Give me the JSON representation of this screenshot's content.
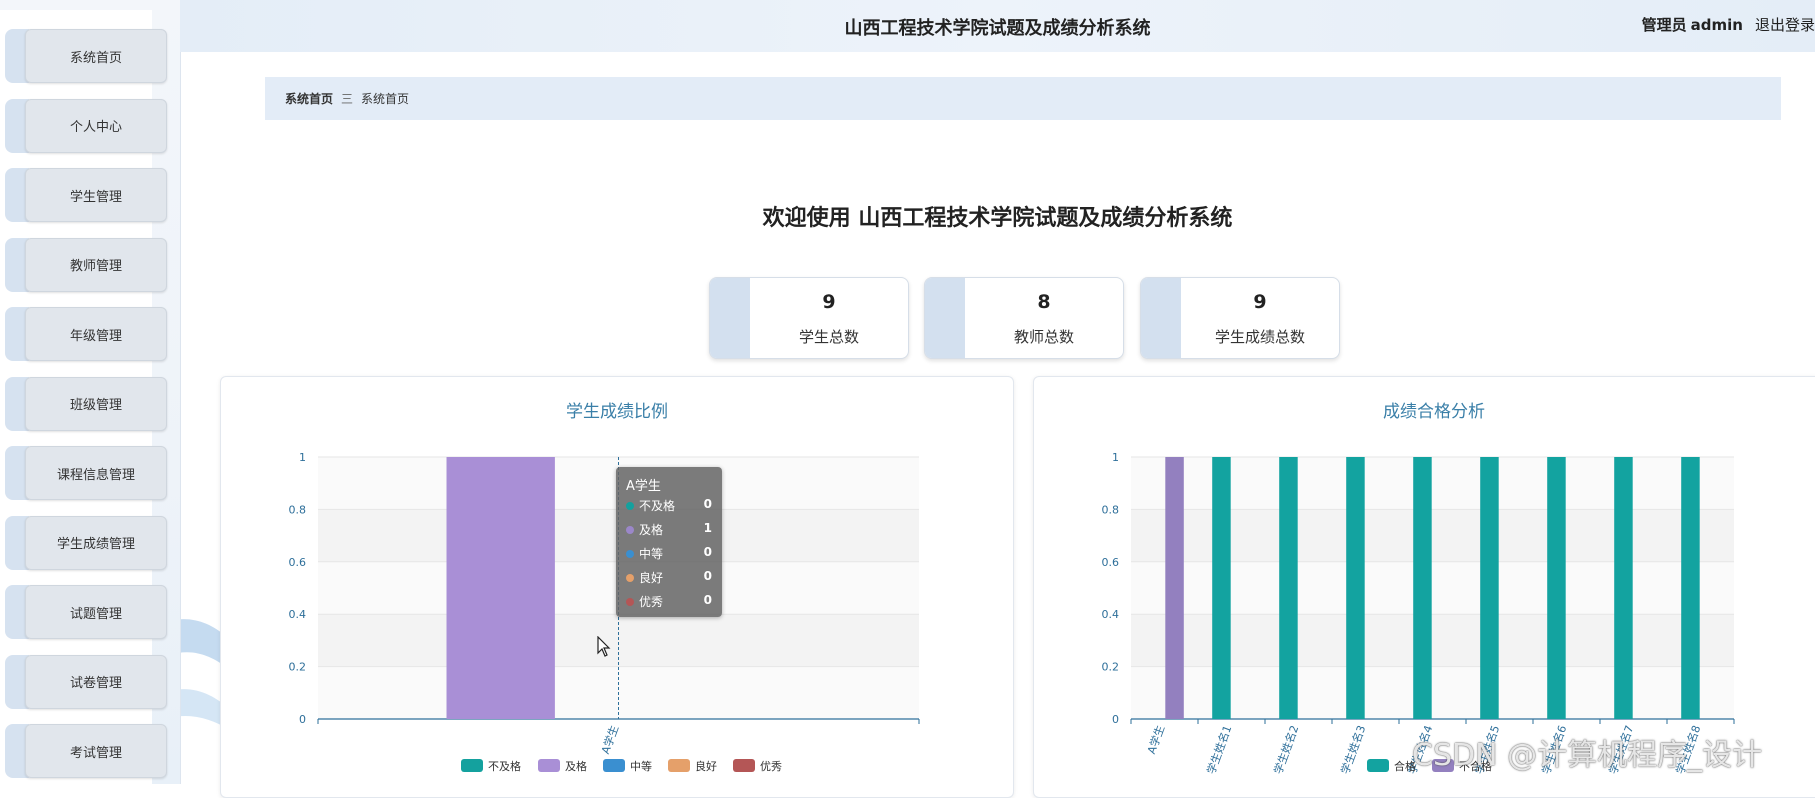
{
  "header": {
    "title": "山西工程技术学院试题及成绩分析系统",
    "user_role": "管理员",
    "user_name": "admin",
    "logout_label": "退出登录"
  },
  "sidebar": {
    "items": [
      {
        "label": "系统首页"
      },
      {
        "label": "个人中心"
      },
      {
        "label": "学生管理"
      },
      {
        "label": "教师管理"
      },
      {
        "label": "年级管理"
      },
      {
        "label": "班级管理"
      },
      {
        "label": "课程信息管理"
      },
      {
        "label": "学生成绩管理"
      },
      {
        "label": "试题管理"
      },
      {
        "label": "试卷管理"
      },
      {
        "label": "考试管理"
      }
    ]
  },
  "breadcrumb": {
    "home": "系统首页",
    "separator": "三",
    "current": "系统首页"
  },
  "welcome": "欢迎使用 山西工程技术学院试题及成绩分析系统",
  "stats": [
    {
      "value": "9",
      "label": "学生总数"
    },
    {
      "value": "8",
      "label": "教师总数"
    },
    {
      "value": "9",
      "label": "学生成绩总数"
    }
  ],
  "tooltip": {
    "title": "A学生",
    "rows": [
      {
        "name": "不及格",
        "value": "0",
        "color": "#14a19e"
      },
      {
        "name": "及格",
        "value": "1",
        "color": "#9b87c9"
      },
      {
        "name": "中等",
        "value": "0",
        "color": "#3a8fd0"
      },
      {
        "name": "良好",
        "value": "0",
        "color": "#e5a06a"
      },
      {
        "name": "优秀",
        "value": "0",
        "color": "#b45656"
      }
    ]
  },
  "watermark": "CSDN @计算机程序_设计",
  "chart_data": [
    {
      "type": "bar",
      "title": "学生成绩比例",
      "categories": [
        "A学生"
      ],
      "series": [
        {
          "name": "不及格",
          "values": [
            0
          ],
          "color": "#14a19e"
        },
        {
          "name": "及格",
          "values": [
            1
          ],
          "color": "#a98fd6"
        },
        {
          "name": "中等",
          "values": [
            0
          ],
          "color": "#3a8fd0"
        },
        {
          "name": "良好",
          "values": [
            0
          ],
          "color": "#e5a06a"
        },
        {
          "name": "优秀",
          "values": [
            0
          ],
          "color": "#b45656"
        }
      ],
      "yticks": [
        "0",
        "0.2",
        "0.4",
        "0.6",
        "0.8",
        "1"
      ],
      "ylim": [
        0,
        1
      ],
      "grid": true,
      "legend": "bottom-center"
    },
    {
      "type": "bar",
      "title": "成绩合格分析",
      "categories": [
        "A学生",
        "学生姓名1",
        "学生姓名2",
        "学生姓名3",
        "学生姓名4",
        "学生姓名5",
        "学生姓名6",
        "学生姓名7",
        "学生姓名8"
      ],
      "series": [
        {
          "name": "合格",
          "values": [
            0,
            1,
            1,
            1,
            1,
            1,
            1,
            1,
            1
          ],
          "color": "#13a3a0"
        },
        {
          "name": "不合格",
          "values": [
            1,
            0,
            0,
            0,
            0,
            0,
            0,
            0,
            0
          ],
          "color": "#9380bf"
        }
      ],
      "yticks": [
        "0",
        "0.2",
        "0.4",
        "0.6",
        "0.8",
        "1"
      ],
      "ylim": [
        0,
        1
      ],
      "grid": true,
      "legend": "bottom-center"
    }
  ]
}
